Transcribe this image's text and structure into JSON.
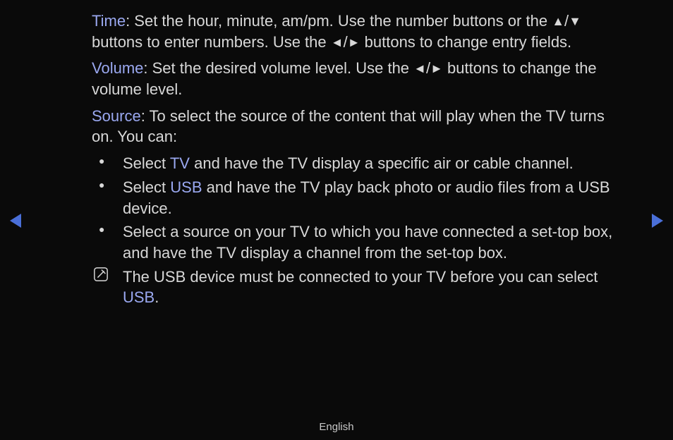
{
  "para_time": {
    "keyword": "Time",
    "t1": ": Set the hour, minute, am/pm. Use the number buttons or the ",
    "arrow_up": "▲",
    "sep1": "/",
    "arrow_down": "▼",
    "t2": " buttons to enter numbers. Use the ",
    "arrow_left": "◄",
    "sep2": "/",
    "arrow_right": "►",
    "t3": " buttons to change entry fields."
  },
  "para_volume": {
    "keyword": "Volume",
    "t1": ": Set the desired volume level. Use the ",
    "arrow_left": "◄",
    "sep": "/",
    "arrow_right": "►",
    "t2": " buttons to change the volume level."
  },
  "para_source": {
    "keyword": "Source",
    "t1": ": To select the source of the content that will play when the TV turns on. You can:"
  },
  "bullets": {
    "b1": {
      "t1": "Select ",
      "kw": "TV",
      "t2": " and have the TV display a specific air or cable channel."
    },
    "b2": {
      "t1": "Select ",
      "kw": "USB",
      "t2": " and have the TV play back photo or audio files from a USB device."
    },
    "b3": {
      "t": "Select a source on your TV to which you have connected a set-top box, and have the TV display a channel from the set-top box."
    },
    "b4": {
      "t1": "The USB device must be connected to your TV before you can select ",
      "kw": "USB",
      "t2": "."
    }
  },
  "footer": "English"
}
